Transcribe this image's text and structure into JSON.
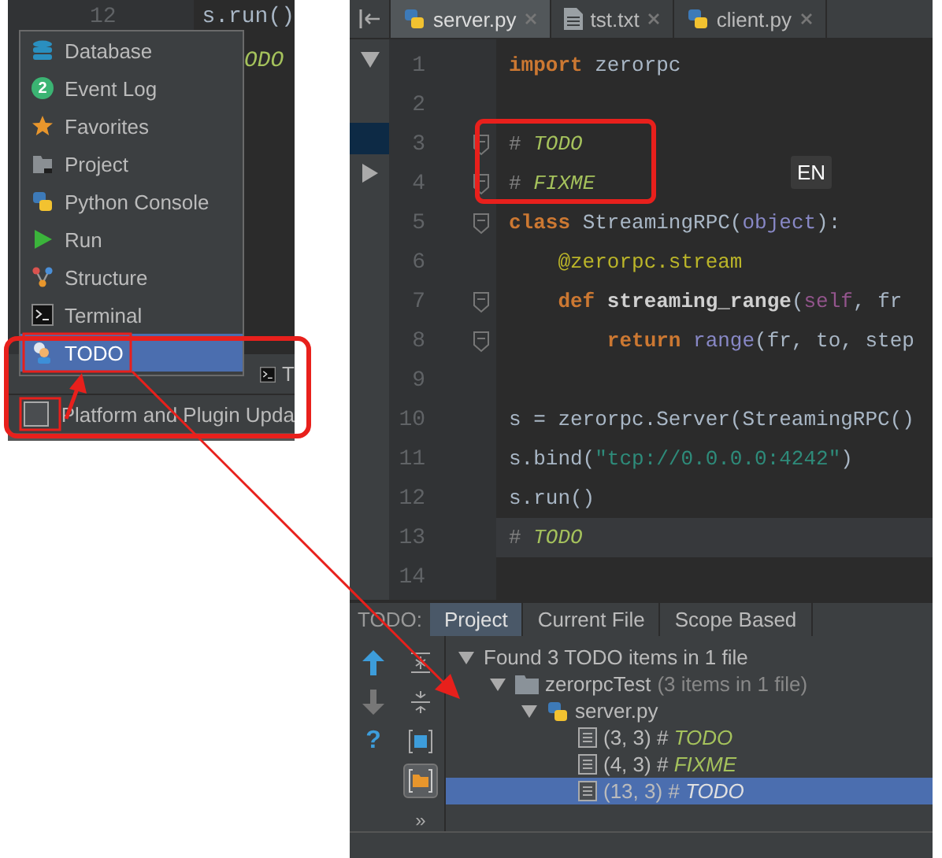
{
  "left_shot": {
    "editor_line": {
      "number": "12",
      "code": "s.run()"
    },
    "hidden_line_tail": "ODO",
    "popup": {
      "items": [
        {
          "label": "Database",
          "kind": "database",
          "selected": false
        },
        {
          "label": "Event Log",
          "kind": "eventlog",
          "badge": "2",
          "selected": false
        },
        {
          "label": "Favorites",
          "kind": "star",
          "selected": false
        },
        {
          "label": "Project",
          "kind": "project",
          "selected": false
        },
        {
          "label": "Python Console",
          "kind": "python",
          "selected": false
        },
        {
          "label": "Run",
          "kind": "run",
          "selected": false
        },
        {
          "label": "Structure",
          "kind": "structure",
          "selected": false
        },
        {
          "label": "Terminal",
          "kind": "terminal",
          "selected": false
        },
        {
          "label": "TODO",
          "kind": "todo",
          "selected": true
        }
      ]
    },
    "behind_button": "T",
    "status_row": {
      "label": "Platform and Plugin Upda"
    }
  },
  "editor": {
    "tabs": [
      {
        "label": "server.py",
        "kind": "python",
        "selected": true
      },
      {
        "label": "tst.txt",
        "kind": "text",
        "selected": false
      },
      {
        "label": "client.py",
        "kind": "python",
        "selected": false
      }
    ],
    "lines": [
      {
        "number": "1",
        "current": false,
        "fold": false,
        "tokens": [
          {
            "text": "import",
            "kind": "kw"
          },
          {
            "text": " zerorpc",
            "kind": "plain"
          }
        ]
      },
      {
        "number": "2",
        "current": false,
        "fold": false
      },
      {
        "number": "3",
        "current": false,
        "fold": true,
        "tokens": [
          {
            "text": "# ",
            "kind": "mark"
          },
          {
            "text": "TODO",
            "kind": "todo"
          }
        ]
      },
      {
        "number": "4",
        "current": false,
        "fold": true,
        "tokens": [
          {
            "text": "# ",
            "kind": "mark"
          },
          {
            "text": "FIXME",
            "kind": "todo"
          }
        ]
      },
      {
        "number": "5",
        "current": false,
        "fold": true,
        "tokens": [
          {
            "text": "class",
            "kind": "kw"
          },
          {
            "text": " StreamingRPC(",
            "kind": "plain"
          },
          {
            "text": "object",
            "kind": "builtin"
          },
          {
            "text": "):",
            "kind": "plain"
          }
        ]
      },
      {
        "number": "6",
        "current": false,
        "fold": false,
        "tokens": [
          {
            "text": "    @zerorpc.stream",
            "kind": "deco"
          }
        ]
      },
      {
        "number": "7",
        "current": false,
        "fold": true,
        "tokens": [
          {
            "text": "    def",
            "kind": "kw"
          },
          {
            "text": " streaming_range",
            "kind": "fn"
          },
          {
            "text": "(",
            "kind": "plain"
          },
          {
            "text": "self",
            "kind": "self"
          },
          {
            "text": ", fr",
            "kind": "plain"
          }
        ]
      },
      {
        "number": "8",
        "current": false,
        "fold": true,
        "tokens": [
          {
            "text": "        return",
            "kind": "kw"
          },
          {
            "text": " range",
            "kind": "builtin"
          },
          {
            "text": "(fr, to, step",
            "kind": "plain"
          }
        ]
      },
      {
        "number": "9",
        "current": false,
        "fold": false
      },
      {
        "number": "10",
        "current": false,
        "fold": false,
        "tokens": [
          {
            "text": "s = zerorpc.Server(StreamingRPC()",
            "kind": "plain"
          }
        ]
      },
      {
        "number": "11",
        "current": false,
        "fold": false,
        "tokens": [
          {
            "text": "s.bind(",
            "kind": "plain"
          },
          {
            "text": "\"tcp://0.0.0.0:4242\"",
            "kind": "str"
          },
          {
            "text": ")",
            "kind": "plain"
          }
        ]
      },
      {
        "number": "12",
        "current": false,
        "fold": false,
        "tokens": [
          {
            "text": "s.run()",
            "kind": "plain"
          }
        ]
      },
      {
        "number": "13",
        "current": true,
        "fold": false,
        "tokens": [
          {
            "text": "# ",
            "kind": "mark"
          },
          {
            "text": "TODO",
            "kind": "todo"
          }
        ]
      },
      {
        "number": "14",
        "current": false,
        "fold": false
      }
    ],
    "ime_badge": "EN"
  },
  "todo_panel": {
    "title": "TODO:",
    "tabs": [
      {
        "label": "Project",
        "selected": true
      },
      {
        "label": "Current File",
        "selected": false
      },
      {
        "label": "Scope Based",
        "selected": false
      }
    ],
    "help_glyph": "?",
    "more_glyph": "»",
    "tree": {
      "kind": "summary",
      "label": "Found 3 TODO items in 1 file",
      "expanded": true,
      "children": [
        {
          "kind": "folder",
          "label": "zerorpcTest",
          "note": "(3 items in 1 file)",
          "expanded": true,
          "children": [
            {
              "kind": "file",
              "label": "server.py",
              "expanded": true,
              "children": [
                {
                  "kind": "item",
                  "location": "(3, 3)",
                  "mark": "#",
                  "tag": "TODO",
                  "selected": false
                },
                {
                  "kind": "item",
                  "location": "(4, 3)",
                  "mark": "#",
                  "tag": "FIXME",
                  "selected": false
                },
                {
                  "kind": "item",
                  "location": "(13, 3)",
                  "mark": "#",
                  "tag": "TODO",
                  "selected": true
                }
              ]
            }
          ]
        }
      ]
    }
  }
}
